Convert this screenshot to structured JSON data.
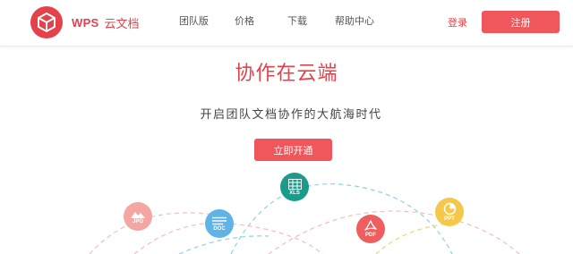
{
  "header": {
    "brand_en": "WPS",
    "brand_cn": "云文档",
    "nav": {
      "team": "团队版",
      "price": "价格",
      "download": "下载",
      "help": "帮助中心"
    },
    "login": "登录",
    "register": "注册"
  },
  "hero": {
    "title": "协作在云端",
    "subtitle": "开启团队文档协作的大航海时代",
    "cta": "立即开通"
  },
  "file_icons": {
    "xls": "XLS",
    "jpg": "JPG",
    "doc": "DOC",
    "pdf": "PDF",
    "ppt": "PPT"
  },
  "colors": {
    "brand": "#e5414a",
    "button": "#f0575c",
    "xls": "#199c8c",
    "jpg": "#f4a6a2",
    "doc": "#5fb3e6",
    "pdf": "#ef5e5f",
    "ppt": "#f6c84a"
  }
}
